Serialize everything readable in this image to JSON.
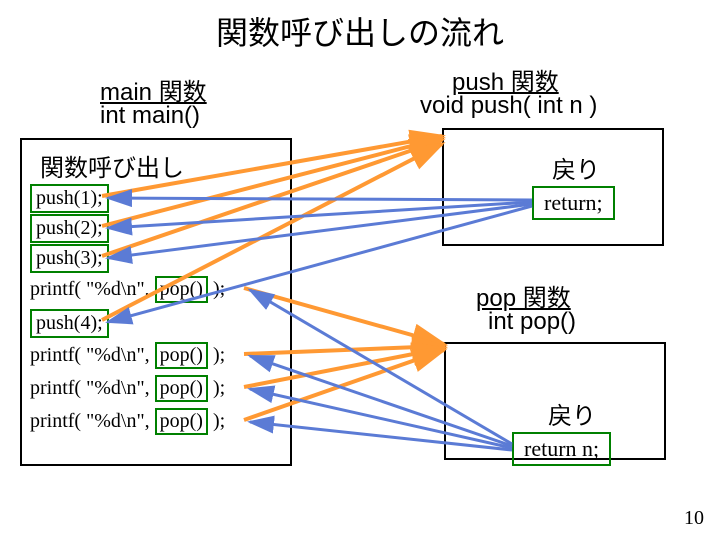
{
  "title": "関数呼び出しの流れ",
  "main": {
    "label": "main 関数",
    "sig": "int main()"
  },
  "push": {
    "label": "push 関数",
    "sig": "void push( int n )",
    "ret_label": "戻り",
    "ret_code": "return;"
  },
  "pop": {
    "label": "pop 関数",
    "sig": "int pop()",
    "ret_label": "戻り",
    "ret_code": "return n;"
  },
  "code": {
    "call_label": "関数呼び出し",
    "l1": "push(1);",
    "l2": "push(2);",
    "l3": "push(3);",
    "printf_pre": "printf( \"%d\\n\", ",
    "printf_post": " );",
    "pop_call": "pop()",
    "l5": "push(4);"
  },
  "pagenum": "10"
}
